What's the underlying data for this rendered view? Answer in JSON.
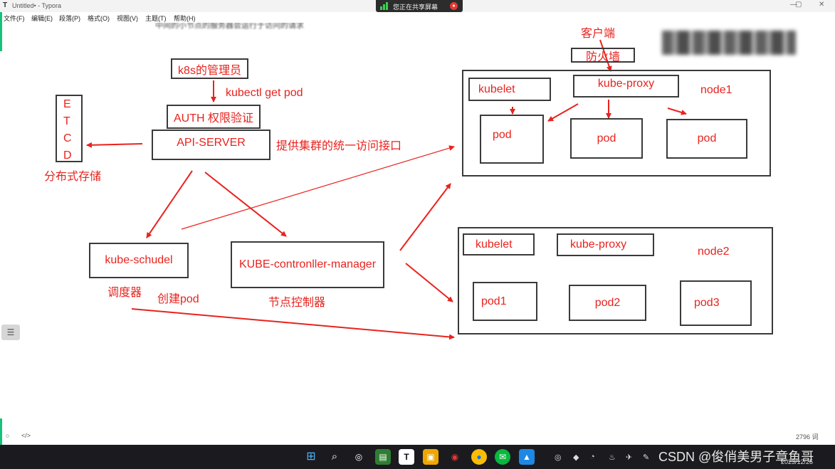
{
  "window": {
    "title": "Untitled• - Typora",
    "app_glyph": "T",
    "min": "—",
    "max": "▢",
    "close": "✕"
  },
  "share_banner": {
    "text": "您正在共享屏幕",
    "stop_glyph": "●"
  },
  "menubar": [
    "文件(F)",
    "编辑(E)",
    "段落(P)",
    "格式(O)",
    "视图(V)",
    "主题(T)",
    "帮助(H)"
  ],
  "document": {
    "cut_text": "中间的小节点的服务器会运行于访问的请求",
    "diagram": {
      "client": "客户端",
      "firewall": "防火墙",
      "admin": "k8s的管理员",
      "kubectl": "kubectl get pod",
      "auth": "AUTH 权限验证",
      "api_server": "API-SERVER",
      "api_desc": "提供集群的统一访问接口",
      "etcd": [
        "E",
        "T",
        "C",
        "D"
      ],
      "etcd_desc": "分布式存储",
      "scheduler": "kube-schudel",
      "scheduler_desc": "调度器",
      "create_pod": "创建pod",
      "controller": "KUBE-contronller-manager",
      "controller_desc": "节点控制器",
      "node1": {
        "name": "node1",
        "kubelet": "kubelet",
        "proxy": "kube-proxy",
        "pods": [
          "pod",
          "pod",
          "pod"
        ]
      },
      "node2": {
        "name": "node2",
        "kubelet": "kubelet",
        "proxy": "kube-proxy",
        "pods": [
          "pod1",
          "pod2",
          "pod3"
        ]
      }
    },
    "arrow_color": "#e8231e",
    "label_color": "#e8231e"
  },
  "statusbar": {
    "left_icon": "○",
    "source_icon": "</>",
    "word_count": "2796 词"
  },
  "taskbar": {
    "watermark": "CSDN @俊俏美男子章鱼哥",
    "date": "2023/12/25",
    "icons": [
      "windows-icon",
      "search-icon",
      "widgets-icon",
      "notepad-icon",
      "typora-icon",
      "files-icon",
      "music-icon",
      "chrome-icon",
      "wechat-icon",
      "meeting-icon"
    ]
  }
}
